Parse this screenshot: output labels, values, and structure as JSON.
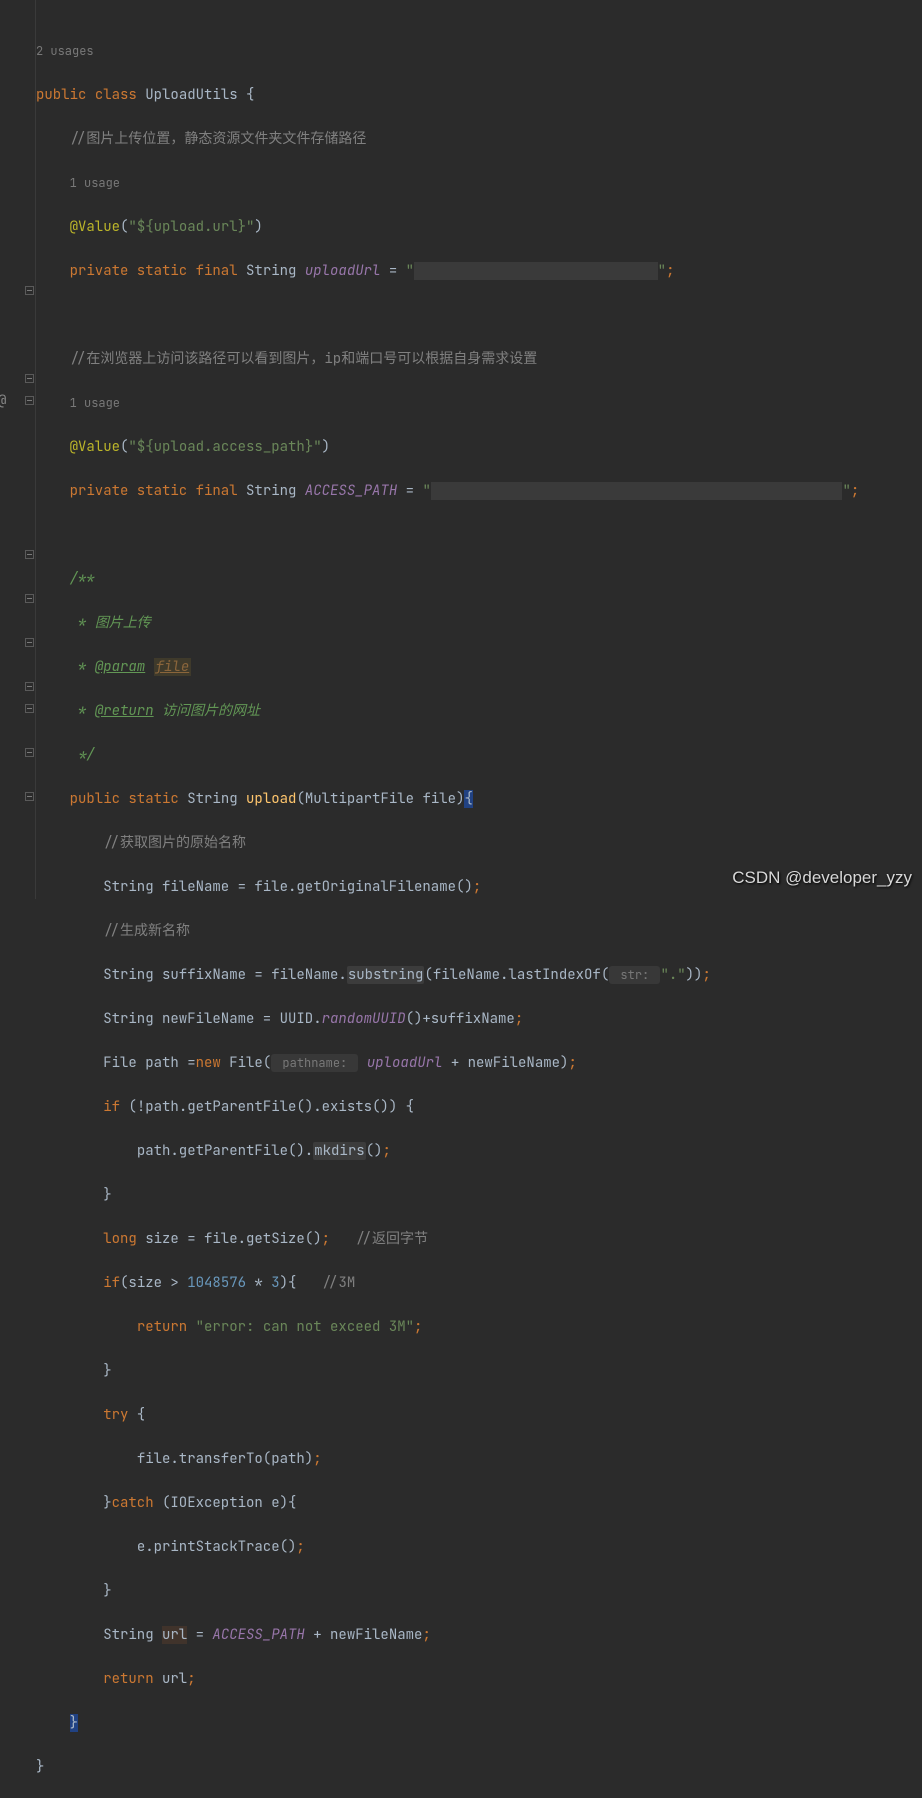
{
  "usages": {
    "class": "2 usages",
    "field1": "1 usage",
    "field2": "1 usage"
  },
  "decl": {
    "public": "public",
    "class": "class",
    "name": "UploadUtils",
    "brace": "{"
  },
  "cmt1": "//图片上传位置，静态资源文件夹文件存储路径",
  "ann1": {
    "at": "@Value",
    "open": "(",
    "val": "\"${upload.url}\"",
    "close": ")"
  },
  "f1": {
    "mods": "private static final",
    "type": "String",
    "name": "uploadUrl",
    "eq": " = ",
    "q1": "\"",
    "redact": "                             ",
    "q2": "\"",
    "semi": ";"
  },
  "cmt2": "//在浏览器上访问该路径可以看到图片，ip和端口号可以根据自身需求设置",
  "ann2": {
    "at": "@Value",
    "open": "(",
    "val": "\"${upload.access_path}\"",
    "close": ")"
  },
  "f2": {
    "mods": "private static final",
    "type": "String",
    "name": "ACCESS_PATH",
    "eq": " = ",
    "q1": "\"",
    "redact": "                                                 ",
    "q2": "\"",
    "semi": ";"
  },
  "jd": {
    "l1": "/**",
    "l2a": " * ",
    "l2b": "图片上传",
    "l3a": " * ",
    "l3b": "@param",
    "l3c": " ",
    "l3d": "file",
    "l4a": " * ",
    "l4b": "@return",
    "l4c": " ",
    "l4d": "访问图片的网址",
    "l5": " */"
  },
  "sig": {
    "mods": "public static",
    "ret": "String",
    "name": "upload",
    "open": "(",
    "ptype": "MultipartFile",
    "pname": "file",
    "close": ")",
    "brace": "{"
  },
  "body": {
    "c1": "//获取图片的原始名称",
    "l1": {
      "a": "String fileName = file.getOriginalFilename()",
      "b": ";"
    },
    "c2": "//生成新名称",
    "l2": {
      "a": "String suffixName = fileName.",
      "b": "substring",
      "c": "(fileName.lastIndexOf(",
      "hint": " str: ",
      "d": "\".\"",
      "e": "))",
      "f": ";"
    },
    "l3": {
      "a": "String newFileName = UUID.",
      "b": "randomUUID",
      "c": "()+suffixName",
      "d": ";"
    },
    "l4": {
      "a": "File path =",
      "nw": "new",
      "b": " File(",
      "hint": " pathname: ",
      "fld": "uploadUrl",
      "c": " + newFileName)",
      "d": ";"
    },
    "l5": {
      "kw": "if",
      "a": " (!path.getParentFile().exists()) {"
    },
    "l6": {
      "a": "path.getParentFile().",
      "b": "mkdirs",
      "c": "()",
      "d": ";"
    },
    "l7": "}",
    "l8": {
      "kw": "long",
      "a": " size = file.getSize()",
      "b": ";",
      "c": "   ",
      "d": "//返回字节"
    },
    "l9": {
      "kw": "if",
      "a": "(size > ",
      "n1": "1048576",
      "b": " * ",
      "n2": "3",
      "c": "){   ",
      "d": "//3M"
    },
    "l10": {
      "kw": "return",
      "a": " ",
      "s": "\"error: can not exceed 3M\"",
      "b": ";"
    },
    "l11": "}",
    "l12": {
      "kw": "try",
      "a": " {"
    },
    "l13": {
      "a": "file.transferTo(path)",
      "b": ";"
    },
    "l14": {
      "a": "}",
      "kw": "catch",
      "b": " (IOException e){"
    },
    "l15": {
      "a": "e.printStackTrace()",
      "b": ";"
    },
    "l16": "}",
    "l17": {
      "a": "String ",
      "v": "url",
      "b": " = ",
      "fld": "ACCESS_PATH",
      "c": " + newFileName",
      "d": ";"
    },
    "l18": {
      "kw": "return",
      "a": " url",
      "b": ";"
    }
  },
  "close": {
    "m": "}",
    "c": "}"
  },
  "watermark": "CSDN @developer_yzy"
}
